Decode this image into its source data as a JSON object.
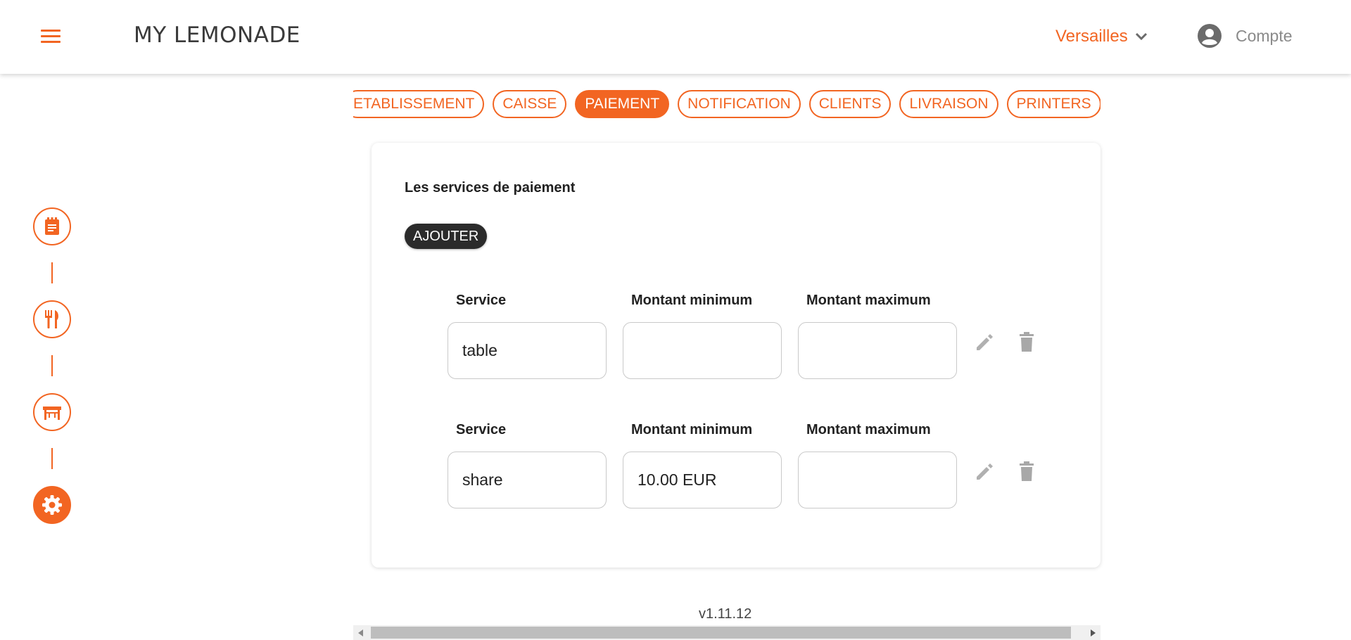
{
  "header": {
    "logo": "MY LEMONADE",
    "location": "Versailles",
    "account_label": "Compte"
  },
  "rail": {
    "items": [
      {
        "icon": "notepad-icon",
        "active": false
      },
      {
        "icon": "fork-knife-icon",
        "active": false
      },
      {
        "icon": "table-icon",
        "active": false
      },
      {
        "icon": "gear-icon",
        "active": true
      }
    ]
  },
  "tabs": [
    {
      "label": "ETABLISSEMENT",
      "active": false
    },
    {
      "label": "CAISSE",
      "active": false
    },
    {
      "label": "PAIEMENT",
      "active": true
    },
    {
      "label": "NOTIFICATION",
      "active": false
    },
    {
      "label": "CLIENTS",
      "active": false
    },
    {
      "label": "LIVRAISON",
      "active": false
    },
    {
      "label": "PRINTERS",
      "active": false
    }
  ],
  "payment": {
    "title": "Les services de paiement",
    "add_label": "AJOUTER",
    "column_labels": {
      "service": "Service",
      "min": "Montant minimum",
      "max": "Montant maximum"
    },
    "rows": [
      {
        "service": "table",
        "min": "",
        "max": ""
      },
      {
        "service": "share",
        "min": "10.00 EUR",
        "max": ""
      }
    ]
  },
  "version": "v1.11.12",
  "colors": {
    "accent": "#f26522",
    "dark_button": "#2b2b2b"
  }
}
